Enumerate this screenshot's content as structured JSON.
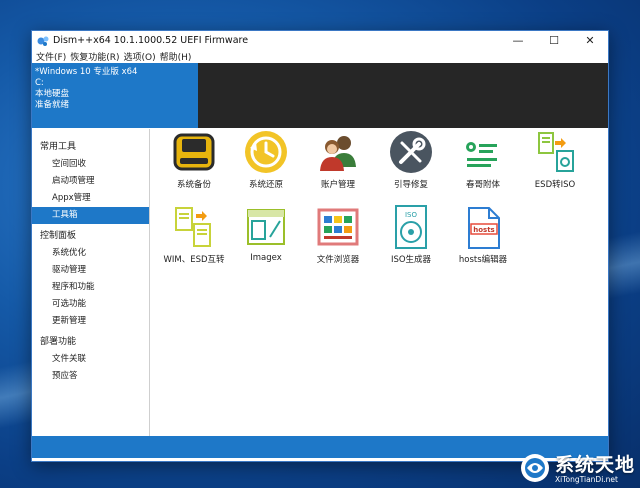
{
  "window": {
    "title": "Dism++x64 10.1.1000.52 UEFI Firmware",
    "min_glyph": "—",
    "max_glyph": "☐",
    "close_glyph": "✕"
  },
  "menu": [
    "文件(F)",
    "恢复功能(R)",
    "选项(O)",
    "帮助(H)"
  ],
  "info": {
    "lines": [
      "*Windows 10 专业版 x64",
      "C:",
      "本地硬盘",
      "准备就绪"
    ]
  },
  "sidebar": {
    "sections": [
      {
        "header": "常用工具",
        "items": [
          "空间回收",
          "启动项管理",
          "Appx管理",
          "工具箱"
        ]
      },
      {
        "header": "控制面板",
        "items": [
          "系统优化",
          "驱动管理",
          "程序和功能",
          "可选功能",
          "更新管理"
        ]
      },
      {
        "header": "部署功能",
        "items": [
          "文件关联",
          "预应答"
        ]
      }
    ],
    "active_item": "工具箱"
  },
  "tools": [
    {
      "label": "系统备份",
      "icon": "backup-drive-icon"
    },
    {
      "label": "系统还原",
      "icon": "restore-clock-icon"
    },
    {
      "label": "账户管理",
      "icon": "users-icon"
    },
    {
      "label": "引导修复",
      "icon": "tools-wrench-icon"
    },
    {
      "label": "春哥附体",
      "icon": "settings-list-icon"
    },
    {
      "label": "ESD转ISO",
      "icon": "esd-iso-convert-icon"
    },
    {
      "label": "WIM、ESD互转",
      "icon": "wim-esd-convert-icon"
    },
    {
      "label": "Imagex",
      "icon": "imagex-icon"
    },
    {
      "label": "文件浏览器",
      "icon": "file-browser-icon"
    },
    {
      "label": "ISO生成器",
      "icon": "iso-disc-icon"
    },
    {
      "label": "hosts编辑器",
      "icon": "hosts-file-icon"
    }
  ],
  "watermark": {
    "title": "系统天地",
    "subtitle": "XiTongTianDi.net"
  },
  "colors": {
    "accent": "#1e78c8",
    "info_dark": "#262626"
  }
}
